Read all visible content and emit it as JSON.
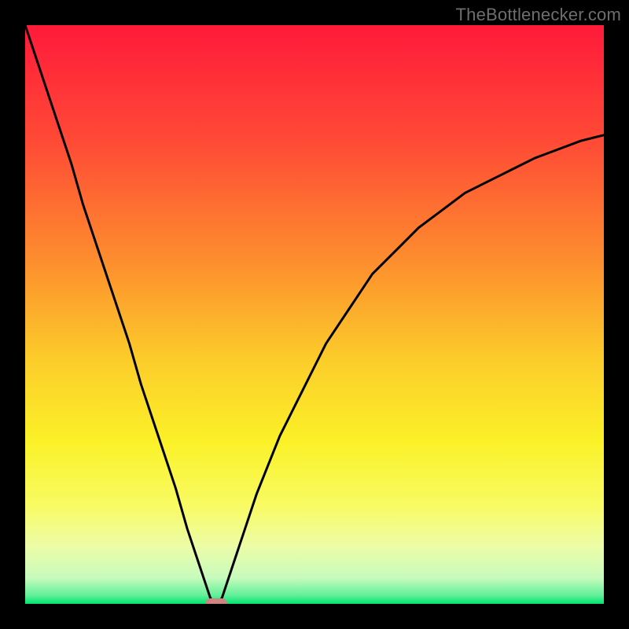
{
  "watermark": {
    "text": "TheBottlenecker.com"
  },
  "chart_data": {
    "type": "line",
    "title": "",
    "xlabel": "",
    "ylabel": "",
    "xlim": [
      0,
      100
    ],
    "ylim": [
      0,
      100
    ],
    "x": [
      0,
      2,
      4,
      6,
      8,
      10,
      12,
      14,
      16,
      18,
      20,
      22,
      24,
      26,
      28,
      30,
      31,
      32,
      33,
      34,
      35,
      36,
      38,
      40,
      42,
      44,
      46,
      48,
      50,
      52,
      54,
      56,
      58,
      60,
      64,
      68,
      72,
      76,
      80,
      84,
      88,
      92,
      96,
      100
    ],
    "values": [
      100,
      94,
      88,
      82,
      76,
      69,
      63,
      57,
      51,
      45,
      38,
      32,
      26,
      20,
      13,
      7,
      4,
      1,
      0,
      1,
      4,
      7,
      13,
      19,
      24,
      29,
      33,
      37,
      41,
      45,
      48,
      51,
      54,
      57,
      61,
      65,
      68,
      71,
      73,
      75,
      77,
      78.5,
      80,
      81
    ],
    "marker": {
      "x": 33,
      "y": 0
    },
    "gradient_stops": [
      {
        "offset": 0,
        "color": "#ff1a3a"
      },
      {
        "offset": 0.2,
        "color": "#ff4a36"
      },
      {
        "offset": 0.4,
        "color": "#fd8b2e"
      },
      {
        "offset": 0.58,
        "color": "#fccd2a"
      },
      {
        "offset": 0.72,
        "color": "#fbf128"
      },
      {
        "offset": 0.83,
        "color": "#f8fb63"
      },
      {
        "offset": 0.9,
        "color": "#edfca6"
      },
      {
        "offset": 0.955,
        "color": "#c7fbbd"
      },
      {
        "offset": 0.985,
        "color": "#63f09a"
      },
      {
        "offset": 1.0,
        "color": "#00e56f"
      }
    ]
  }
}
